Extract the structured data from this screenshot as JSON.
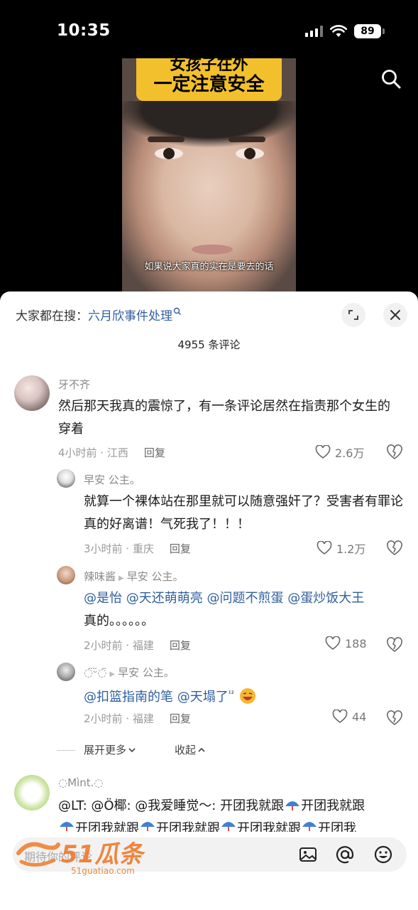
{
  "status_bar": {
    "time": "10:35",
    "battery": "89"
  },
  "video": {
    "banner_line1": "女孩子在外",
    "banner_line2": "一定注意安全",
    "subtitle": "如果说大家真的实在是要去的话"
  },
  "hot_search": {
    "prefix": "大家都在搜：",
    "query": "六月欣事件处理"
  },
  "comments_count": "4955 条评论",
  "comments": [
    {
      "user": "牙不齐",
      "text": "然后那天我真的震惊了，有一条评论居然在指责那个女生的穿着",
      "time_loc": "4小时前 · 江西",
      "reply_label": "回复",
      "likes": "2.6万"
    }
  ],
  "replies": [
    {
      "user": "早安  公主。",
      "text": "就算一个裸体站在那里就可以随意强奸了？受害者有罪论真的好离谱！气死我了！！！",
      "time_loc": "3小时前 · 重庆",
      "reply_label": "回复",
      "likes": "1.2万"
    },
    {
      "user": "辣味酱",
      "reply_to": "早安  公主。",
      "mentions": [
        "@是怡",
        "@天还萌萌亮",
        "@问题不煎蛋",
        "@蛋炒饭大王"
      ],
      "text_after": "真的。。。。。。",
      "time_loc": "2小时前 · 福建",
      "reply_label": "回复",
      "likes": "188"
    },
    {
      "user": "◌̈ᵕ̈◌̈",
      "reply_to": "早安  公主。",
      "mentions": [
        "@扣篮指南的笔",
        "@天塌了"
      ],
      "superscript": "¹²",
      "time_loc": "2小时前 · 福建",
      "reply_label": "回复",
      "likes": "44"
    }
  ],
  "expand": {
    "more": "展开更多",
    "collapse": "收起"
  },
  "comment2": {
    "user": "◌Mìnt.◌",
    "line1": "@LT: @Ö椰: @我爱睡觉～: 开团我就跟",
    "repeat_text": "开团我就跟",
    "line2_parts": [
      "开团我就跟",
      "开团我就跟",
      "开团我就跟",
      "开团我"
    ]
  },
  "input": {
    "placeholder": "期待你的评论"
  },
  "watermark": {
    "brand": "51瓜条",
    "url": "51guatiao.com"
  },
  "colors": {
    "link": "#2f5f9e",
    "banner": "#f3c02d",
    "watermark": "#f07a2a"
  }
}
